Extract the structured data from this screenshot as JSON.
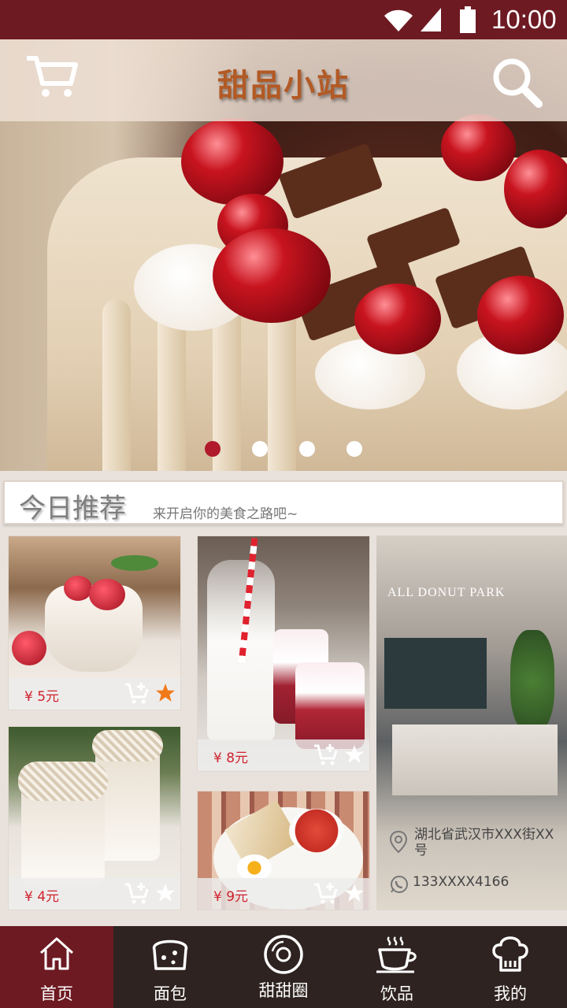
{
  "status_bar": {
    "time": "10:00",
    "icons": [
      "wifi-icon",
      "signal-icon",
      "battery-icon"
    ]
  },
  "header": {
    "title": "甜品小站",
    "left_icon": "cart-icon",
    "right_icon": "search-icon"
  },
  "banner": {
    "slides": 4,
    "active_slide": 1
  },
  "recommend": {
    "heading": "今日推荐",
    "subtitle": "来开启你的美食之路吧~"
  },
  "products": [
    {
      "price": "¥ 5元",
      "favorited": true
    },
    {
      "price": "¥ 4元",
      "favorited": false
    },
    {
      "price": "¥ 8元",
      "favorited": false
    },
    {
      "price": "¥ 9元",
      "favorited": false
    }
  ],
  "shop": {
    "brand": "ALL DONUT PARK",
    "address": "湖北省武汉市XXX街XX号",
    "phone": "133XXXX4166"
  },
  "nav": {
    "items": [
      {
        "label": "首页",
        "icon": "home-icon",
        "active": true
      },
      {
        "label": "面包",
        "icon": "bread-icon",
        "active": false
      },
      {
        "label": "甜甜圈",
        "icon": "donut-icon",
        "active": false
      },
      {
        "label": "饮品",
        "icon": "coffee-cup-icon",
        "active": false
      },
      {
        "label": "我的",
        "icon": "chef-hat-icon",
        "active": false
      }
    ]
  },
  "colors": {
    "brand": "#6e1a22",
    "title": "#b25a25",
    "price": "#d0222e",
    "star_active": "#f07a1a",
    "nav_bg": "#2e2320"
  }
}
